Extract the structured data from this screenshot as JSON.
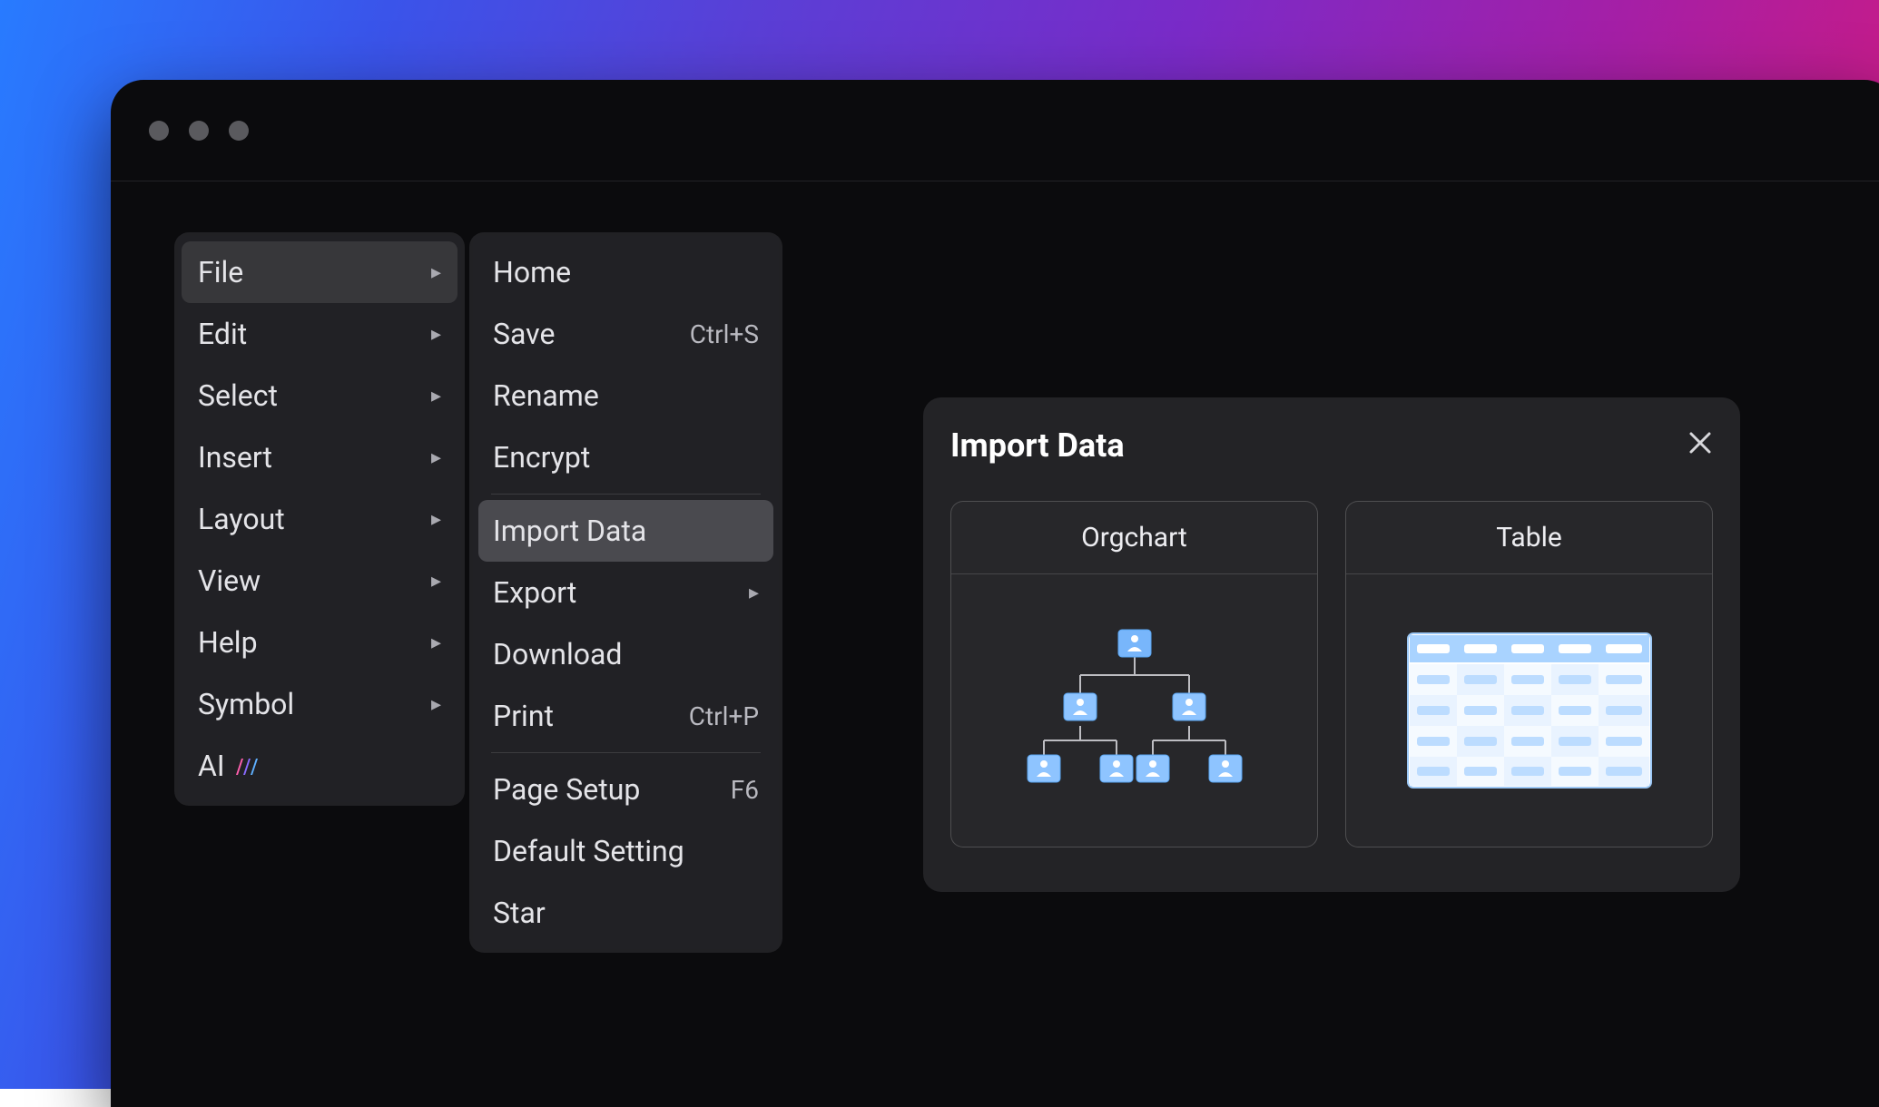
{
  "window": {
    "traffic_lights": [
      "close",
      "minimize",
      "zoom"
    ]
  },
  "menu": {
    "items": [
      {
        "label": "File",
        "has_submenu": true,
        "active": true
      },
      {
        "label": "Edit",
        "has_submenu": true,
        "active": false
      },
      {
        "label": "Select",
        "has_submenu": true,
        "active": false
      },
      {
        "label": "Insert",
        "has_submenu": true,
        "active": false
      },
      {
        "label": "Layout",
        "has_submenu": true,
        "active": false
      },
      {
        "label": "View",
        "has_submenu": true,
        "active": false
      },
      {
        "label": "Help",
        "has_submenu": true,
        "active": false
      },
      {
        "label": "Symbol",
        "has_submenu": true,
        "active": false
      },
      {
        "label": "AI",
        "has_submenu": false,
        "active": false,
        "badge": "ai"
      }
    ]
  },
  "submenu": {
    "groups": [
      [
        {
          "label": "Home",
          "shortcut": ""
        },
        {
          "label": "Save",
          "shortcut": "Ctrl+S"
        },
        {
          "label": "Rename",
          "shortcut": ""
        },
        {
          "label": "Encrypt",
          "shortcut": ""
        }
      ],
      [
        {
          "label": "Import Data",
          "shortcut": "",
          "highlight": true
        },
        {
          "label": "Export",
          "shortcut": "",
          "has_submenu": true
        },
        {
          "label": "Download",
          "shortcut": ""
        },
        {
          "label": "Print",
          "shortcut": "Ctrl+P"
        }
      ],
      [
        {
          "label": "Page Setup",
          "shortcut": "F6"
        },
        {
          "label": "Default Setting",
          "shortcut": ""
        },
        {
          "label": "Star",
          "shortcut": ""
        }
      ]
    ]
  },
  "dialog": {
    "title": "Import Data",
    "close_icon": "close-icon",
    "cards": [
      {
        "title": "Orgchart",
        "name": "orgchart"
      },
      {
        "title": "Table",
        "name": "table"
      }
    ]
  }
}
